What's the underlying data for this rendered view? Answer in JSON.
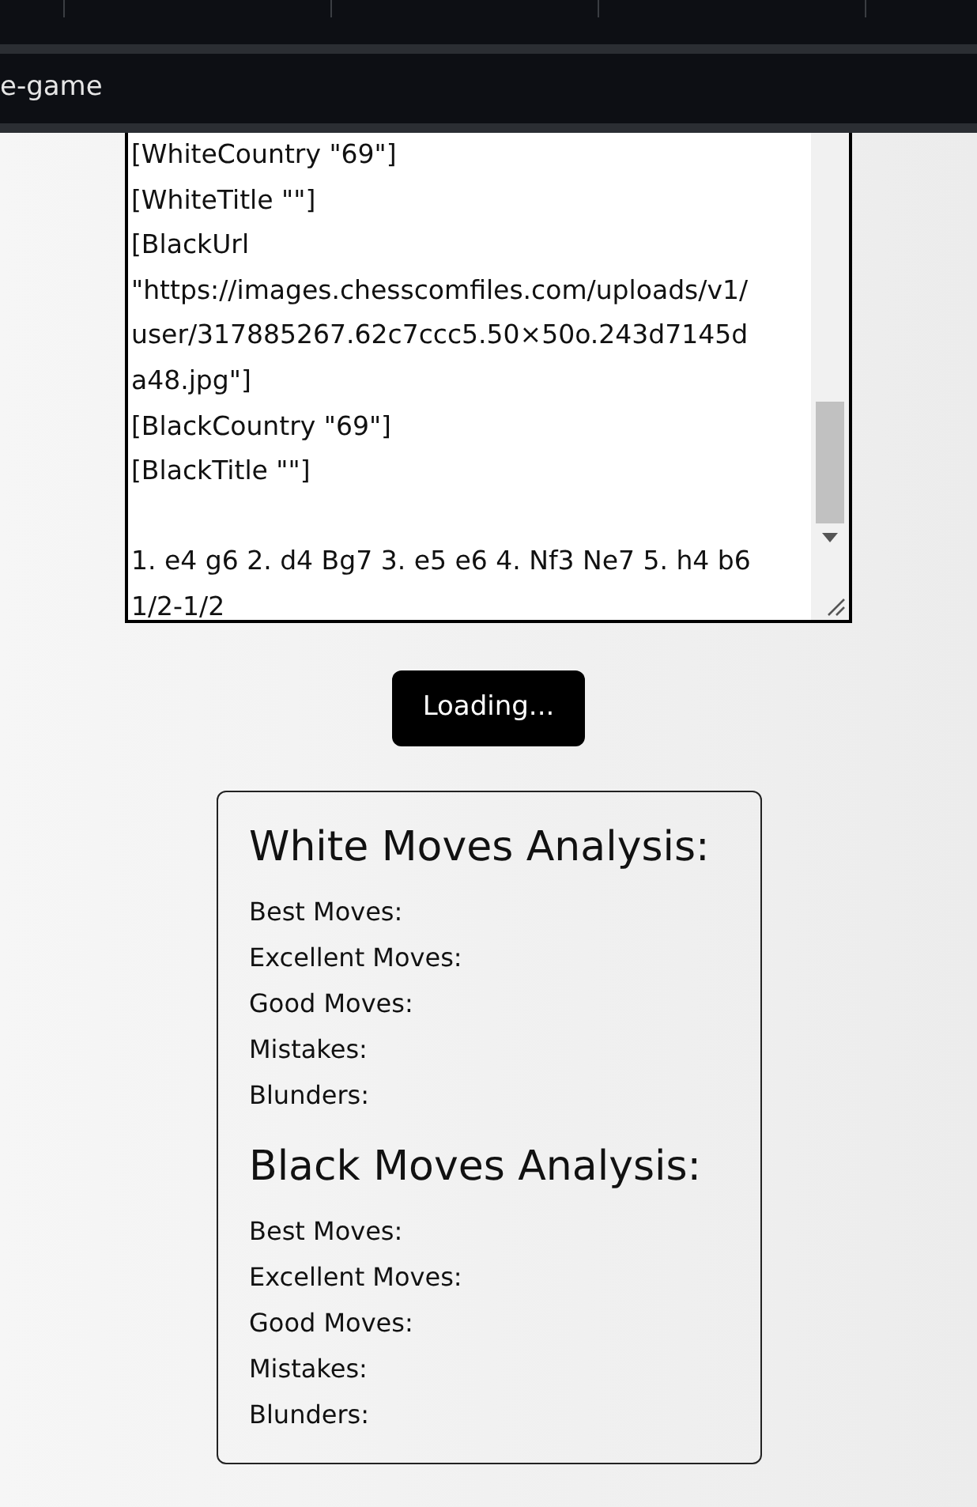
{
  "address_bar": {
    "text": "e-game"
  },
  "pgn_box": {
    "lines": [
      {
        "kind": "tag",
        "text": "[WhiteCountry \"69\"]"
      },
      {
        "kind": "tag",
        "text": "[WhiteTitle \"\"]"
      },
      {
        "kind": "tag",
        "text": "[BlackUrl"
      },
      {
        "kind": "tag",
        "text": "\"https://images.chesscomfiles.com/uploads/v1/"
      },
      {
        "kind": "tag",
        "text": "user/317885267.62c7ccc5.50×50o.243d7145d"
      },
      {
        "kind": "tag",
        "text": "a48.jpg\"]"
      },
      {
        "kind": "tag",
        "text": "[BlackCountry \"69\"]"
      },
      {
        "kind": "tag",
        "text": "[BlackTitle \"\"]"
      },
      {
        "kind": "moves",
        "text": "1. e4 g6 2. d4 Bg7 3. e5 e6 4. Nf3 Ne7 5. h4 b6"
      },
      {
        "kind": "moves",
        "text": "1/2-1/2"
      }
    ]
  },
  "analyze_button": {
    "label": "Loading..."
  },
  "analysis": [
    {
      "title": "White Moves Analysis:",
      "items": [
        "Best Moves:",
        "Excellent Moves:",
        "Good Moves:",
        "Mistakes:",
        "Blunders:"
      ]
    },
    {
      "title": "Black Moves Analysis:",
      "items": [
        "Best Moves:",
        "Excellent Moves:",
        "Good Moves:",
        "Mistakes:",
        "Blunders:"
      ]
    }
  ]
}
